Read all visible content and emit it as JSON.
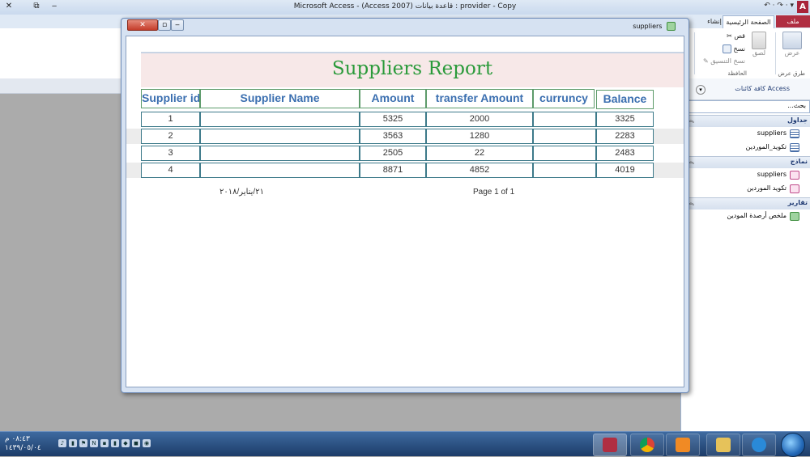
{
  "app": {
    "window_title": "Microsoft Access - (Access 2007) قاعدة بيانات : provider - Copy",
    "quick_access": "↶ · ↷ · ▾",
    "app_icon_letter": "A",
    "window_controls": {
      "close": "✕",
      "restore": "⧉",
      "minimize": "‒"
    },
    "ribbon_min": "⌃",
    "help": "?"
  },
  "ribbon": {
    "tabs": {
      "file": "ملف",
      "home": "الصفحة الرئيسية",
      "create": "إنشاء"
    },
    "view_label": "عرض",
    "paste_label": "لصق",
    "cut_label": "قص",
    "copy_label": "نسخ",
    "format_painter_label": "نسخ التنسيق",
    "group_clipboard": "الحافظة",
    "group_views": "طرق عرض"
  },
  "nav_pane": {
    "title": "كافة كائنات Access",
    "search_placeholder": "...بحث",
    "groups": [
      {
        "label": "جداول",
        "items": [
          "suppliers",
          "تكويد_الموردين"
        ]
      },
      {
        "label": "نماذج",
        "items": [
          "suppliers",
          "تكويد الموردين"
        ]
      },
      {
        "label": "تقارير",
        "items": [
          "ملخص أرصدة المودين"
        ]
      }
    ]
  },
  "report_window": {
    "title": "suppliers",
    "report_title": "Suppliers Report",
    "headers": {
      "id": "Supplier id",
      "name": "Supplier Name",
      "amount": "Amount",
      "transfer": "transfer Amount",
      "currency": "curruncy",
      "balance": "Balance"
    },
    "rows": [
      {
        "id": "1",
        "name": "",
        "amount": "5325",
        "transfer": "2000",
        "currency": "",
        "balance": "3325"
      },
      {
        "id": "2",
        "name": "",
        "amount": "3563",
        "transfer": "1280",
        "currency": "",
        "balance": "2283"
      },
      {
        "id": "3",
        "name": "",
        "amount": "2505",
        "transfer": "22",
        "currency": "",
        "balance": "2483"
      },
      {
        "id": "4",
        "name": "",
        "amount": "8871",
        "transfer": "4852",
        "currency": "",
        "balance": "4019"
      }
    ],
    "footer_date": "٢١/يناير/٢٠١٨",
    "footer_page": "Page 1 of 1"
  },
  "taskbar": {
    "time": "٠٨:٤٣ م",
    "date": "١٤٣٩/٠٥/٠٤"
  }
}
